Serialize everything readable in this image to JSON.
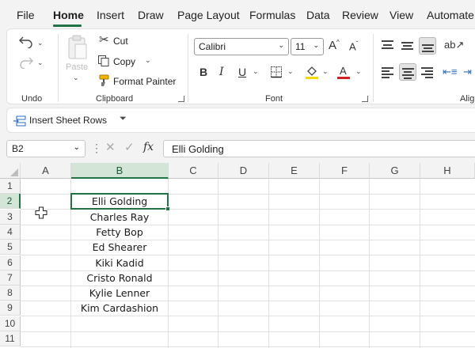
{
  "menu": {
    "tabs": [
      "File",
      "Home",
      "Insert",
      "Draw",
      "Page Layout",
      "Formulas",
      "Data",
      "Review",
      "View",
      "Automate"
    ],
    "active": "Home"
  },
  "ribbon": {
    "undo_group": {
      "label": "Undo"
    },
    "clipboard": {
      "label": "Clipboard",
      "paste": "Paste",
      "cut": "Cut",
      "copy": "Copy",
      "format_painter": "Format Painter"
    },
    "font": {
      "label": "Font",
      "font_name": "Calibri",
      "font_size": "11",
      "bold": "B",
      "italic": "I",
      "underline": "U",
      "fill_color": "#f5d800",
      "font_color": "#d21f1f"
    },
    "alignment": {
      "label": "Alig"
    }
  },
  "quick_access": {
    "insert_rows": "Insert Sheet Rows"
  },
  "formula_bar": {
    "name_box": "B2",
    "fx": "fx",
    "value": "Elli Golding"
  },
  "grid": {
    "columns": [
      "A",
      "B",
      "C",
      "D",
      "E",
      "F",
      "G",
      "H"
    ],
    "selected_column": "B",
    "rows": [
      "1",
      "2",
      "3",
      "4",
      "5",
      "6",
      "7",
      "8",
      "9",
      "10",
      "11"
    ],
    "selected_row": "2",
    "column_b": [
      "",
      "Elli Golding",
      "Charles Ray",
      "Fetty Bop",
      "Ed Shearer",
      "Kiki Kadid",
      "Cristo Ronald",
      "Kylie Lenner",
      "Kim Cardashion",
      "",
      ""
    ],
    "accent": "#217346"
  }
}
